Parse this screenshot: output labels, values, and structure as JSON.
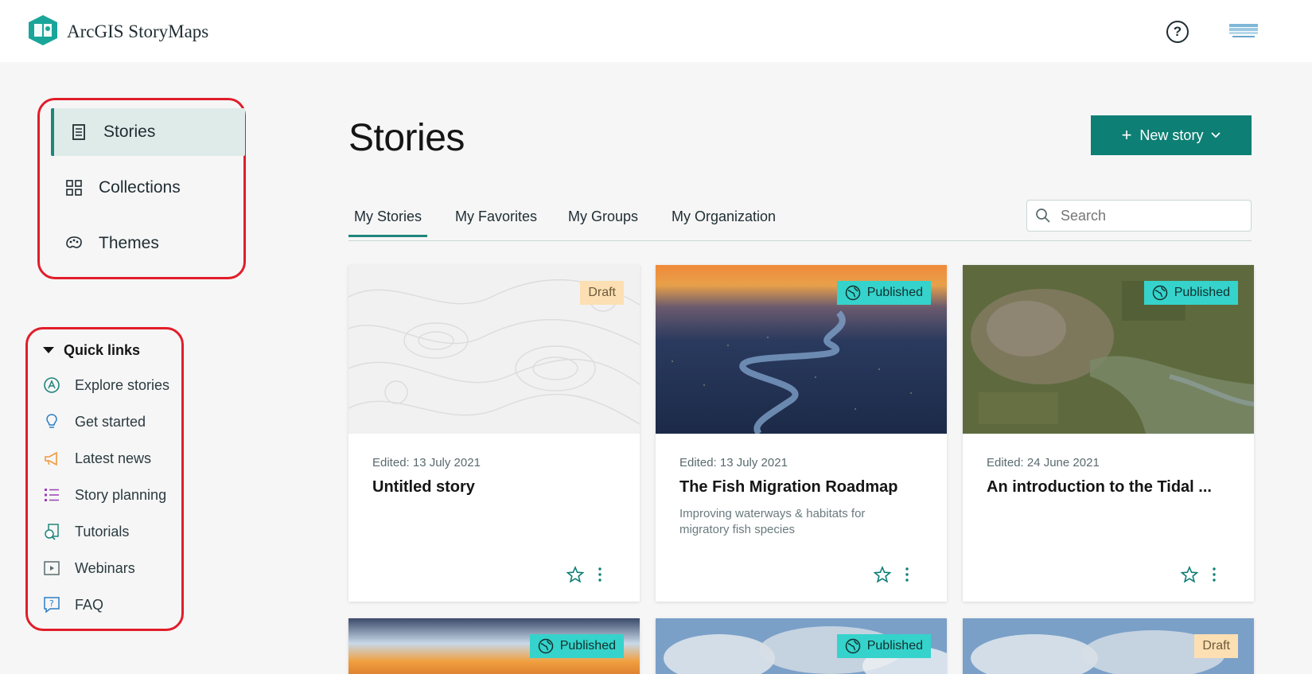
{
  "header": {
    "app_title": "ArcGIS StoryMaps",
    "help_label": "?"
  },
  "nav": {
    "items": [
      {
        "label": "Stories",
        "icon": "document-icon",
        "active": true
      },
      {
        "label": "Collections",
        "icon": "grid-icon",
        "active": false
      },
      {
        "label": "Themes",
        "icon": "palette-icon",
        "active": false
      }
    ]
  },
  "quick_links": {
    "heading": "Quick links",
    "items": [
      {
        "label": "Explore stories",
        "icon": "explore-icon",
        "color": "#20857c"
      },
      {
        "label": "Get started",
        "icon": "lightbulb-icon",
        "color": "#2b7fc7"
      },
      {
        "label": "Latest news",
        "icon": "megaphone-icon",
        "color": "#f09a3e"
      },
      {
        "label": "Story planning",
        "icon": "list-icon",
        "color": "#9b3fb5"
      },
      {
        "label": "Tutorials",
        "icon": "tutorial-icon",
        "color": "#20857c"
      },
      {
        "label": "Webinars",
        "icon": "play-icon",
        "color": "#5a6a6e"
      },
      {
        "label": "FAQ",
        "icon": "faq-icon",
        "color": "#2b7fc7"
      }
    ]
  },
  "main": {
    "title": "Stories",
    "new_story_label": "New story",
    "tabs": [
      "My Stories",
      "My Favorites",
      "My Groups",
      "My Organization"
    ],
    "search_placeholder": "Search",
    "cards": [
      {
        "status": "Draft",
        "edited": "Edited: 13 July 2021",
        "title": "Untitled story",
        "description": ""
      },
      {
        "status": "Published",
        "edited": "Edited: 13 July 2021",
        "title": "The Fish Migration Roadmap",
        "description": "Improving waterways & habitats for migratory fish species"
      },
      {
        "status": "Published",
        "edited": "Edited: 24 June 2021",
        "title": "An introduction to the Tidal ...",
        "description": ""
      },
      {
        "status": "Published"
      },
      {
        "status": "Published"
      },
      {
        "status": "Draft"
      }
    ]
  },
  "colors": {
    "accent": "#0e7f75",
    "annotation": "#e11d2a",
    "draft_badge": "#fcdfb2",
    "published_badge": "#35d3cb"
  }
}
